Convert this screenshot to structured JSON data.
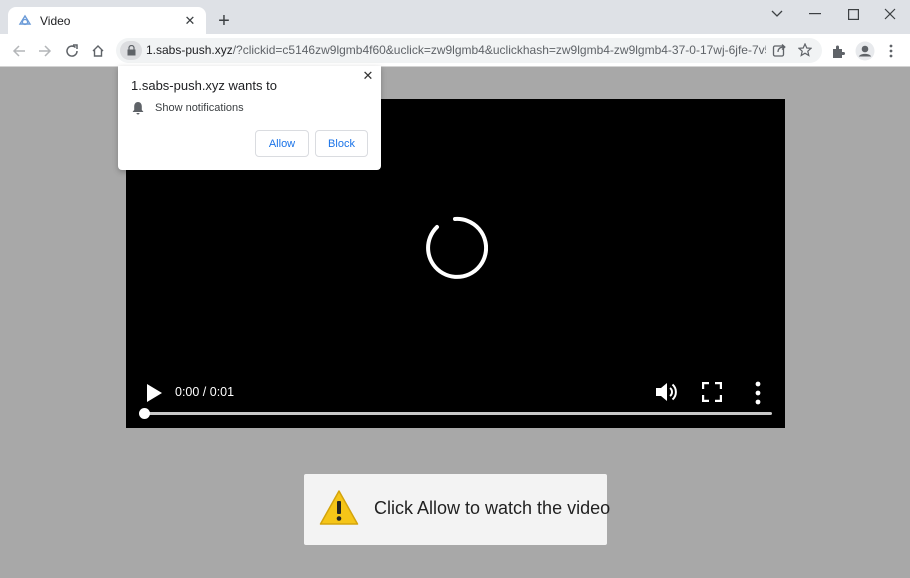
{
  "browser": {
    "tab_title": "Video",
    "url_host": "1.sabs-push.xyz",
    "url_rest": "/?clickid=c5146zw9lgmb4f60&uclick=zw9lgmb4&uclickhash=zw9lgmb4-zw9lgmb4-37-0-17wj-6jfe-7v5..."
  },
  "notification": {
    "title": "1.sabs-push.xyz wants to",
    "permission": "Show notifications",
    "allow_label": "Allow",
    "block_label": "Block"
  },
  "video": {
    "time": "0:00 / 0:01",
    "progress": 0
  },
  "banner": {
    "text": "Click Allow to watch the video"
  },
  "colors": {
    "page_bg": "#a8a8a8",
    "link_blue": "#1a73e8",
    "warning_yellow": "#f5c518"
  }
}
